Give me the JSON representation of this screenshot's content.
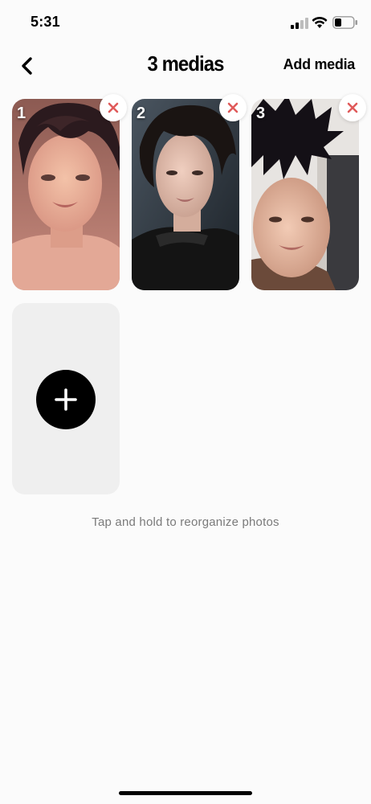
{
  "status_bar": {
    "time": "5:31",
    "icons": [
      "cellular-signal-icon",
      "wifi-icon",
      "battery-icon"
    ]
  },
  "header": {
    "back_icon": "chevron-left-icon",
    "title": "3 medias",
    "add_media_label": "Add media"
  },
  "media": [
    {
      "number": "1",
      "remove_icon": "close-x-icon"
    },
    {
      "number": "2",
      "remove_icon": "close-x-icon"
    },
    {
      "number": "3",
      "remove_icon": "close-x-icon"
    }
  ],
  "add_tile": {
    "icon": "plus-icon"
  },
  "hint": "Tap and hold to reorganize photos",
  "colors": {
    "background": "#fbfbfb",
    "remove_x": "#e05a5a",
    "add_tile_bg": "#efefef",
    "hint_text": "#7a7a7a"
  }
}
